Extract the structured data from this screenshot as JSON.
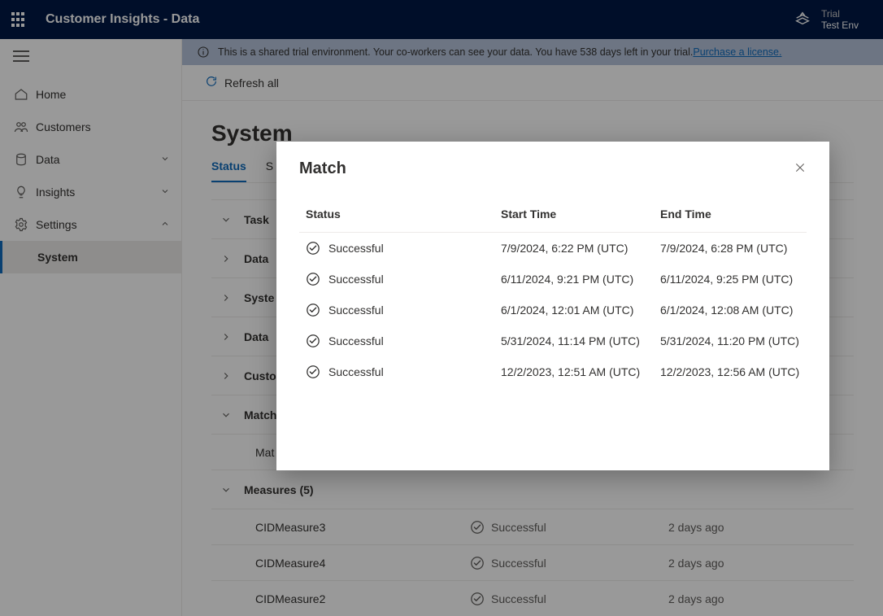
{
  "topbar": {
    "app_title": "Customer Insights - Data",
    "env_label": "Trial",
    "env_name": "Test Env"
  },
  "banner": {
    "text_prefix": "This is a shared trial environment. Your co-workers can see your data. You have 538 days left in your trial. ",
    "link": "Purchase a license."
  },
  "cmdbar": {
    "refresh_all": "Refresh all"
  },
  "nav": {
    "home": "Home",
    "customers": "Customers",
    "data": "Data",
    "insights": "Insights",
    "settings": "Settings",
    "system": "System"
  },
  "page": {
    "title": "System",
    "tabs": {
      "status": "Status",
      "second_partial": "S"
    },
    "col_task": "Task",
    "groups": {
      "data": "Data",
      "syste": "Syste",
      "data2": "Data",
      "custo": "Custo",
      "match_group": "Match",
      "mat_row": "Mat",
      "measures": "Measures (5)"
    },
    "measures": [
      {
        "name": "CIDMeasure3",
        "status": "Successful",
        "time": "2 days ago"
      },
      {
        "name": "CIDMeasure4",
        "status": "Successful",
        "time": "2 days ago"
      },
      {
        "name": "CIDMeasure2",
        "status": "Successful",
        "time": "2 days ago"
      }
    ]
  },
  "modal": {
    "title": "Match",
    "cols": {
      "status": "Status",
      "start": "Start Time",
      "end": "End Time"
    },
    "rows": [
      {
        "status": "Successful",
        "start": "7/9/2024, 6:22 PM (UTC)",
        "end": "7/9/2024, 6:28 PM (UTC)"
      },
      {
        "status": "Successful",
        "start": "6/11/2024, 9:21 PM (UTC)",
        "end": "6/11/2024, 9:25 PM (UTC)"
      },
      {
        "status": "Successful",
        "start": "6/1/2024, 12:01 AM (UTC)",
        "end": "6/1/2024, 12:08 AM (UTC)"
      },
      {
        "status": "Successful",
        "start": "5/31/2024, 11:14 PM (UTC)",
        "end": "5/31/2024, 11:20 PM (UTC)"
      },
      {
        "status": "Successful",
        "start": "12/2/2023, 12:51 AM (UTC)",
        "end": "12/2/2023, 12:56 AM (UTC)"
      }
    ]
  }
}
